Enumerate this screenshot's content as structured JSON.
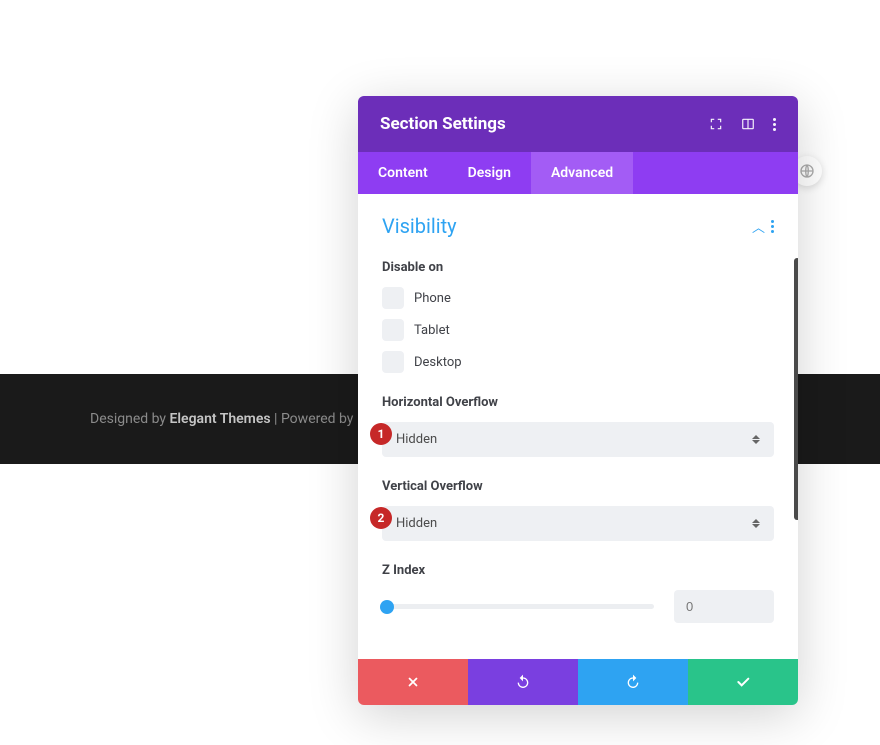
{
  "footer": {
    "designed_by_prefix": "Designed by ",
    "designed_by_name": "Elegant Themes",
    "powered_by": " | Powered by "
  },
  "modal": {
    "title": "Section Settings",
    "tabs": {
      "content": "Content",
      "design": "Design",
      "advanced": "Advanced"
    }
  },
  "visibility": {
    "title": "Visibility",
    "disable_on_label": "Disable on",
    "options": {
      "phone": "Phone",
      "tablet": "Tablet",
      "desktop": "Desktop"
    }
  },
  "horizontal_overflow": {
    "label": "Horizontal Overflow",
    "value": "Hidden",
    "badge": "1"
  },
  "vertical_overflow": {
    "label": "Vertical Overflow",
    "value": "Hidden",
    "badge": "2"
  },
  "zindex": {
    "label": "Z Index",
    "value": "0"
  }
}
